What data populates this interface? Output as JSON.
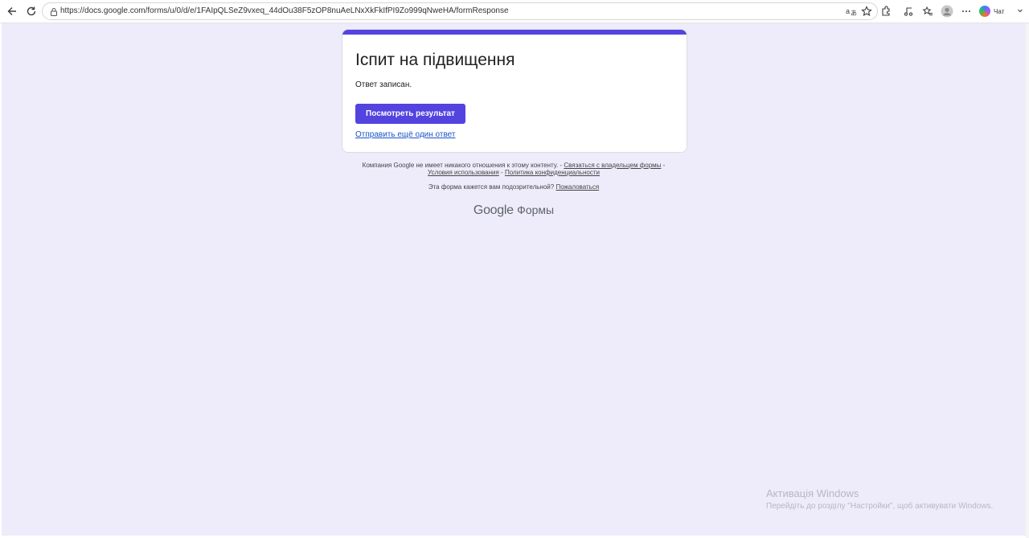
{
  "browser": {
    "url": "https://docs.google.com/forms/u/0/d/e/1FAIpQLSeZ9vxeq_44dOu38F5zOP8nuAeLNxXkFkIfPI9Zo999qNweHA/formResponse",
    "chat_label": "Чат"
  },
  "form": {
    "title": "Іспит на підвищення",
    "message": "Ответ записан.",
    "view_result_label": "Посмотреть результат",
    "submit_another_label": "Отправить ещё один ответ",
    "accent_color": "#5344e0"
  },
  "footer": {
    "disclaimer": "Компания Google не имеет никакого отношения к этому контенту. -",
    "contact_owner": "Связаться с владельцем формы",
    "sep1": "-",
    "terms": "Условия использования",
    "sep2": "-",
    "privacy": "Политика конфиденциальности",
    "suspicious": "Эта форма кажется вам подозрительной?",
    "report": "Пожаловаться",
    "brand_google": "Google",
    "brand_forms": "Формы"
  },
  "windows_activation": {
    "title": "Активація Windows",
    "subtitle": "Перейдіть до розділу \"Настройки\", щоб активувати Windows."
  },
  "icons": [
    "back-icon",
    "reload-icon",
    "lock-icon",
    "translate-icon",
    "favorite-star-icon",
    "extensions-icon",
    "media-icon",
    "favorites-icon",
    "profile-avatar-icon",
    "copilot-icon",
    "more-icon",
    "chevron-down-icon"
  ]
}
